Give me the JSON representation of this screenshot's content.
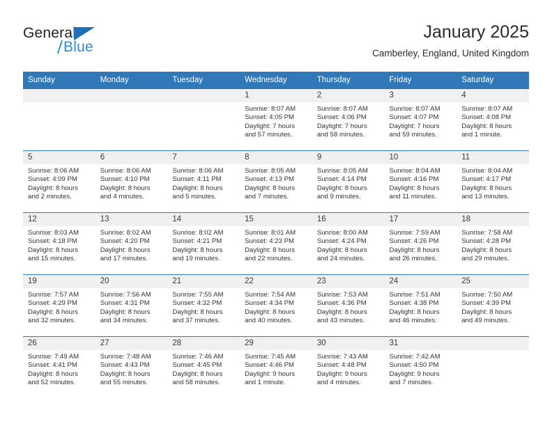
{
  "logo": {
    "word_top": "General",
    "word_bottom": "Blue",
    "triangle_color": "#1f6fb5",
    "blue_color": "#2c8bd4",
    "dark_color": "#231f20"
  },
  "header": {
    "title": "January 2025",
    "subtitle": "Camberley, England, United Kingdom"
  },
  "theme": {
    "header_bg": "#3178b9",
    "daynum_bg": "#f0f0f0",
    "text": "#333333"
  },
  "weekdays": [
    "Sunday",
    "Monday",
    "Tuesday",
    "Wednesday",
    "Thursday",
    "Friday",
    "Saturday"
  ],
  "weeks": [
    [
      {
        "day": "",
        "sunrise": "",
        "sunset": "",
        "daylight_1": "",
        "daylight_2": ""
      },
      {
        "day": "",
        "sunrise": "",
        "sunset": "",
        "daylight_1": "",
        "daylight_2": ""
      },
      {
        "day": "",
        "sunrise": "",
        "sunset": "",
        "daylight_1": "",
        "daylight_2": ""
      },
      {
        "day": "1",
        "sunrise": "Sunrise: 8:07 AM",
        "sunset": "Sunset: 4:05 PM",
        "daylight_1": "Daylight: 7 hours",
        "daylight_2": "and 57 minutes."
      },
      {
        "day": "2",
        "sunrise": "Sunrise: 8:07 AM",
        "sunset": "Sunset: 4:06 PM",
        "daylight_1": "Daylight: 7 hours",
        "daylight_2": "and 58 minutes."
      },
      {
        "day": "3",
        "sunrise": "Sunrise: 8:07 AM",
        "sunset": "Sunset: 4:07 PM",
        "daylight_1": "Daylight: 7 hours",
        "daylight_2": "and 59 minutes."
      },
      {
        "day": "4",
        "sunrise": "Sunrise: 8:07 AM",
        "sunset": "Sunset: 4:08 PM",
        "daylight_1": "Daylight: 8 hours",
        "daylight_2": "and 1 minute."
      }
    ],
    [
      {
        "day": "5",
        "sunrise": "Sunrise: 8:06 AM",
        "sunset": "Sunset: 4:09 PM",
        "daylight_1": "Daylight: 8 hours",
        "daylight_2": "and 2 minutes."
      },
      {
        "day": "6",
        "sunrise": "Sunrise: 8:06 AM",
        "sunset": "Sunset: 4:10 PM",
        "daylight_1": "Daylight: 8 hours",
        "daylight_2": "and 4 minutes."
      },
      {
        "day": "7",
        "sunrise": "Sunrise: 8:06 AM",
        "sunset": "Sunset: 4:11 PM",
        "daylight_1": "Daylight: 8 hours",
        "daylight_2": "and 5 minutes."
      },
      {
        "day": "8",
        "sunrise": "Sunrise: 8:05 AM",
        "sunset": "Sunset: 4:13 PM",
        "daylight_1": "Daylight: 8 hours",
        "daylight_2": "and 7 minutes."
      },
      {
        "day": "9",
        "sunrise": "Sunrise: 8:05 AM",
        "sunset": "Sunset: 4:14 PM",
        "daylight_1": "Daylight: 8 hours",
        "daylight_2": "and 9 minutes."
      },
      {
        "day": "10",
        "sunrise": "Sunrise: 8:04 AM",
        "sunset": "Sunset: 4:16 PM",
        "daylight_1": "Daylight: 8 hours",
        "daylight_2": "and 11 minutes."
      },
      {
        "day": "11",
        "sunrise": "Sunrise: 8:04 AM",
        "sunset": "Sunset: 4:17 PM",
        "daylight_1": "Daylight: 8 hours",
        "daylight_2": "and 13 minutes."
      }
    ],
    [
      {
        "day": "12",
        "sunrise": "Sunrise: 8:03 AM",
        "sunset": "Sunset: 4:18 PM",
        "daylight_1": "Daylight: 8 hours",
        "daylight_2": "and 15 minutes."
      },
      {
        "day": "13",
        "sunrise": "Sunrise: 8:02 AM",
        "sunset": "Sunset: 4:20 PM",
        "daylight_1": "Daylight: 8 hours",
        "daylight_2": "and 17 minutes."
      },
      {
        "day": "14",
        "sunrise": "Sunrise: 8:02 AM",
        "sunset": "Sunset: 4:21 PM",
        "daylight_1": "Daylight: 8 hours",
        "daylight_2": "and 19 minutes."
      },
      {
        "day": "15",
        "sunrise": "Sunrise: 8:01 AM",
        "sunset": "Sunset: 4:23 PM",
        "daylight_1": "Daylight: 8 hours",
        "daylight_2": "and 22 minutes."
      },
      {
        "day": "16",
        "sunrise": "Sunrise: 8:00 AM",
        "sunset": "Sunset: 4:24 PM",
        "daylight_1": "Daylight: 8 hours",
        "daylight_2": "and 24 minutes."
      },
      {
        "day": "17",
        "sunrise": "Sunrise: 7:59 AM",
        "sunset": "Sunset: 4:26 PM",
        "daylight_1": "Daylight: 8 hours",
        "daylight_2": "and 26 minutes."
      },
      {
        "day": "18",
        "sunrise": "Sunrise: 7:58 AM",
        "sunset": "Sunset: 4:28 PM",
        "daylight_1": "Daylight: 8 hours",
        "daylight_2": "and 29 minutes."
      }
    ],
    [
      {
        "day": "19",
        "sunrise": "Sunrise: 7:57 AM",
        "sunset": "Sunset: 4:29 PM",
        "daylight_1": "Daylight: 8 hours",
        "daylight_2": "and 32 minutes."
      },
      {
        "day": "20",
        "sunrise": "Sunrise: 7:56 AM",
        "sunset": "Sunset: 4:31 PM",
        "daylight_1": "Daylight: 8 hours",
        "daylight_2": "and 34 minutes."
      },
      {
        "day": "21",
        "sunrise": "Sunrise: 7:55 AM",
        "sunset": "Sunset: 4:32 PM",
        "daylight_1": "Daylight: 8 hours",
        "daylight_2": "and 37 minutes."
      },
      {
        "day": "22",
        "sunrise": "Sunrise: 7:54 AM",
        "sunset": "Sunset: 4:34 PM",
        "daylight_1": "Daylight: 8 hours",
        "daylight_2": "and 40 minutes."
      },
      {
        "day": "23",
        "sunrise": "Sunrise: 7:53 AM",
        "sunset": "Sunset: 4:36 PM",
        "daylight_1": "Daylight: 8 hours",
        "daylight_2": "and 43 minutes."
      },
      {
        "day": "24",
        "sunrise": "Sunrise: 7:51 AM",
        "sunset": "Sunset: 4:38 PM",
        "daylight_1": "Daylight: 8 hours",
        "daylight_2": "and 46 minutes."
      },
      {
        "day": "25",
        "sunrise": "Sunrise: 7:50 AM",
        "sunset": "Sunset: 4:39 PM",
        "daylight_1": "Daylight: 8 hours",
        "daylight_2": "and 49 minutes."
      }
    ],
    [
      {
        "day": "26",
        "sunrise": "Sunrise: 7:49 AM",
        "sunset": "Sunset: 4:41 PM",
        "daylight_1": "Daylight: 8 hours",
        "daylight_2": "and 52 minutes."
      },
      {
        "day": "27",
        "sunrise": "Sunrise: 7:48 AM",
        "sunset": "Sunset: 4:43 PM",
        "daylight_1": "Daylight: 8 hours",
        "daylight_2": "and 55 minutes."
      },
      {
        "day": "28",
        "sunrise": "Sunrise: 7:46 AM",
        "sunset": "Sunset: 4:45 PM",
        "daylight_1": "Daylight: 8 hours",
        "daylight_2": "and 58 minutes."
      },
      {
        "day": "29",
        "sunrise": "Sunrise: 7:45 AM",
        "sunset": "Sunset: 4:46 PM",
        "daylight_1": "Daylight: 9 hours",
        "daylight_2": "and 1 minute."
      },
      {
        "day": "30",
        "sunrise": "Sunrise: 7:43 AM",
        "sunset": "Sunset: 4:48 PM",
        "daylight_1": "Daylight: 9 hours",
        "daylight_2": "and 4 minutes."
      },
      {
        "day": "31",
        "sunrise": "Sunrise: 7:42 AM",
        "sunset": "Sunset: 4:50 PM",
        "daylight_1": "Daylight: 9 hours",
        "daylight_2": "and 7 minutes."
      },
      {
        "day": "",
        "sunrise": "",
        "sunset": "",
        "daylight_1": "",
        "daylight_2": ""
      }
    ]
  ]
}
